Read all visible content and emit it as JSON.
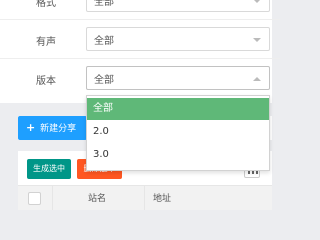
{
  "filters": [
    {
      "label": "格式",
      "value": "全部"
    },
    {
      "label": "有声",
      "value": "全部"
    },
    {
      "label": "版本",
      "value": "全部"
    }
  ],
  "version_dropdown": {
    "options": [
      "全部",
      "2.0",
      "3.0"
    ],
    "selected_index": 0,
    "selected_color": "#5fb878"
  },
  "toolbar": {
    "new_share_label": "新建分享",
    "new_share_icon": "plus-icon",
    "primary_color": "#1e9fff"
  },
  "table": {
    "generate_selected_label": "生成选中",
    "delete_selected_label": "删除选中",
    "generate_color": "#009688",
    "delete_color": "#ff5722",
    "columns_icon": "columns-icon",
    "headers": [
      "站名",
      "地址"
    ]
  }
}
